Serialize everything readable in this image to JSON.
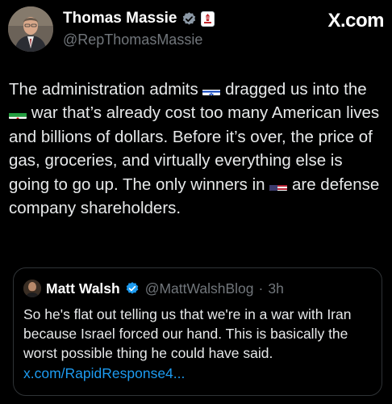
{
  "author": {
    "name": "Thomas Massie",
    "handle": "@RepThomasMassie",
    "verified_icon": "verified-badge-icon",
    "affiliation_icon": "us-house-seal-icon"
  },
  "site": {
    "brand": "X.com"
  },
  "tweet": {
    "part1": "The administration admits ",
    "flag1": "israel-flag",
    "part2": " dragged us into the ",
    "flag2": "iran-flag",
    "part3": " war that’s already cost too many American lives and billions of dollars.  Before it’s over, the price of gas, groceries, and virtually everything else is going to go up. The only winners in ",
    "flag3": "us-flag",
    "part4": " are defense company shareholders."
  },
  "quote": {
    "name": "Matt Walsh",
    "handle": "@MattWalshBlog",
    "separator": "·",
    "time": "3h",
    "text": "So he's flat out telling us that we're in a war with Iran because Israel forced our hand. This is basically the worst possible thing he could have said. ",
    "link": "x.com/RapidResponse4..."
  },
  "colors": {
    "background": "#000000",
    "text": "#e7e9ea",
    "muted": "#71767b",
    "link": "#1d9bf0",
    "verified": "#1d9bf0",
    "border": "#2f3336"
  }
}
